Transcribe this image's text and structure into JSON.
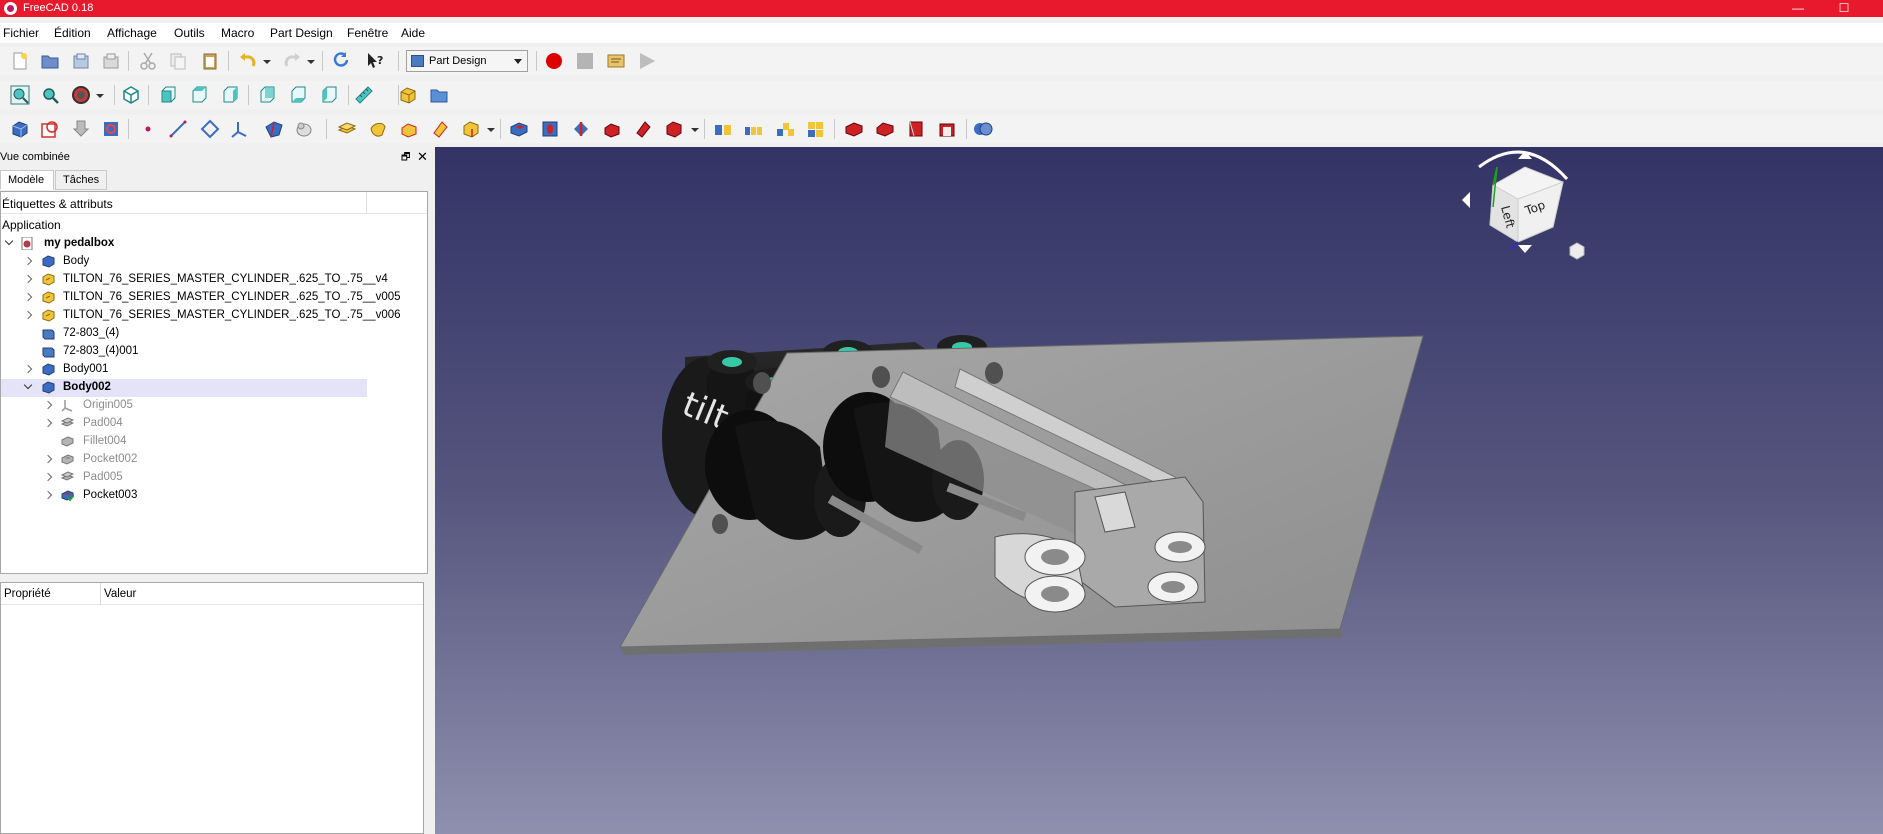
{
  "window": {
    "title": "FreeCAD 0.18",
    "minimize": "—",
    "maximize": "☐"
  },
  "menu": [
    "Fichier",
    "Édition",
    "Affichage",
    "Outils",
    "Macro",
    "Part Design",
    "Fenêtre",
    "Aide"
  ],
  "workbench": {
    "selected": "Part Design"
  },
  "combo": {
    "title": "Vue combinée",
    "float_btn": "🗗",
    "close_btn": "✕"
  },
  "tabs": [
    {
      "label": "Modèle",
      "active": true
    },
    {
      "label": "Tâches",
      "active": false
    }
  ],
  "tree": {
    "header": "Étiquettes & attributs",
    "section": "Application",
    "items": [
      {
        "label": "my pedalbox",
        "icon": "document-icon",
        "expanded": true
      },
      {
        "label": "Body",
        "icon": "body-icon"
      },
      {
        "label": "TILTON_76_SERIES_MASTER_CYLINDER_.625_TO_.75__v4",
        "icon": "part-icon"
      },
      {
        "label": "TILTON_76_SERIES_MASTER_CYLINDER_.625_TO_.75__v005",
        "icon": "part-icon"
      },
      {
        "label": "TILTON_76_SERIES_MASTER_CYLINDER_.625_TO_.75__v006",
        "icon": "part-icon"
      },
      {
        "label": "72-803_(4)",
        "icon": "feature-icon"
      },
      {
        "label": "72-803_(4)001",
        "icon": "feature-icon"
      },
      {
        "label": "Body001",
        "icon": "body-icon"
      },
      {
        "label": "Body002",
        "icon": "body-icon",
        "expanded": true,
        "selected": true
      },
      {
        "label": "Origin005",
        "icon": "origin-icon"
      },
      {
        "label": "Pad004",
        "icon": "pad-icon"
      },
      {
        "label": "Fillet004",
        "icon": "fillet-icon"
      },
      {
        "label": "Pocket002",
        "icon": "pocket-icon"
      },
      {
        "label": "Pad005",
        "icon": "pad-icon"
      },
      {
        "label": "Pocket003",
        "icon": "pocket-active-icon"
      }
    ]
  },
  "properties": {
    "col_property": "Propriété",
    "col_value": "Valeur"
  },
  "viewport": {
    "logo_text": "tilton",
    "navcube": {
      "face_left": "Left",
      "face_top": "Top"
    }
  },
  "colors": {
    "titlebar": "#e8192c",
    "viewport_top": "#333366",
    "viewport_bottom": "#8f8fae",
    "selection": "#e5e3f8"
  }
}
